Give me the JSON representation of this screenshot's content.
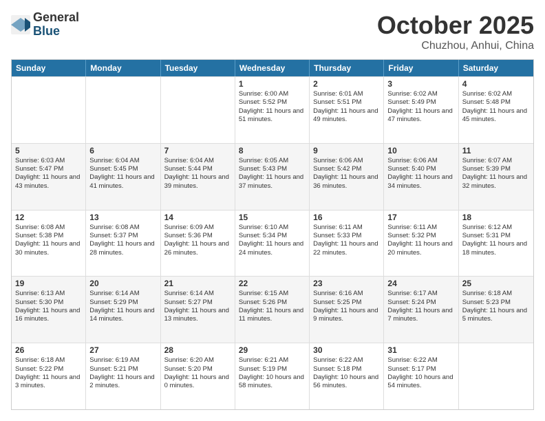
{
  "logo": {
    "general": "General",
    "blue": "Blue"
  },
  "title": "October 2025",
  "subtitle": "Chuzhou, Anhui, China",
  "headers": [
    "Sunday",
    "Monday",
    "Tuesday",
    "Wednesday",
    "Thursday",
    "Friday",
    "Saturday"
  ],
  "rows": [
    [
      {
        "day": "",
        "text": ""
      },
      {
        "day": "",
        "text": ""
      },
      {
        "day": "",
        "text": ""
      },
      {
        "day": "1",
        "text": "Sunrise: 6:00 AM\nSunset: 5:52 PM\nDaylight: 11 hours and 51 minutes."
      },
      {
        "day": "2",
        "text": "Sunrise: 6:01 AM\nSunset: 5:51 PM\nDaylight: 11 hours and 49 minutes."
      },
      {
        "day": "3",
        "text": "Sunrise: 6:02 AM\nSunset: 5:49 PM\nDaylight: 11 hours and 47 minutes."
      },
      {
        "day": "4",
        "text": "Sunrise: 6:02 AM\nSunset: 5:48 PM\nDaylight: 11 hours and 45 minutes."
      }
    ],
    [
      {
        "day": "5",
        "text": "Sunrise: 6:03 AM\nSunset: 5:47 PM\nDaylight: 11 hours and 43 minutes."
      },
      {
        "day": "6",
        "text": "Sunrise: 6:04 AM\nSunset: 5:45 PM\nDaylight: 11 hours and 41 minutes."
      },
      {
        "day": "7",
        "text": "Sunrise: 6:04 AM\nSunset: 5:44 PM\nDaylight: 11 hours and 39 minutes."
      },
      {
        "day": "8",
        "text": "Sunrise: 6:05 AM\nSunset: 5:43 PM\nDaylight: 11 hours and 37 minutes."
      },
      {
        "day": "9",
        "text": "Sunrise: 6:06 AM\nSunset: 5:42 PM\nDaylight: 11 hours and 36 minutes."
      },
      {
        "day": "10",
        "text": "Sunrise: 6:06 AM\nSunset: 5:40 PM\nDaylight: 11 hours and 34 minutes."
      },
      {
        "day": "11",
        "text": "Sunrise: 6:07 AM\nSunset: 5:39 PM\nDaylight: 11 hours and 32 minutes."
      }
    ],
    [
      {
        "day": "12",
        "text": "Sunrise: 6:08 AM\nSunset: 5:38 PM\nDaylight: 11 hours and 30 minutes."
      },
      {
        "day": "13",
        "text": "Sunrise: 6:08 AM\nSunset: 5:37 PM\nDaylight: 11 hours and 28 minutes."
      },
      {
        "day": "14",
        "text": "Sunrise: 6:09 AM\nSunset: 5:36 PM\nDaylight: 11 hours and 26 minutes."
      },
      {
        "day": "15",
        "text": "Sunrise: 6:10 AM\nSunset: 5:34 PM\nDaylight: 11 hours and 24 minutes."
      },
      {
        "day": "16",
        "text": "Sunrise: 6:11 AM\nSunset: 5:33 PM\nDaylight: 11 hours and 22 minutes."
      },
      {
        "day": "17",
        "text": "Sunrise: 6:11 AM\nSunset: 5:32 PM\nDaylight: 11 hours and 20 minutes."
      },
      {
        "day": "18",
        "text": "Sunrise: 6:12 AM\nSunset: 5:31 PM\nDaylight: 11 hours and 18 minutes."
      }
    ],
    [
      {
        "day": "19",
        "text": "Sunrise: 6:13 AM\nSunset: 5:30 PM\nDaylight: 11 hours and 16 minutes."
      },
      {
        "day": "20",
        "text": "Sunrise: 6:14 AM\nSunset: 5:29 PM\nDaylight: 11 hours and 14 minutes."
      },
      {
        "day": "21",
        "text": "Sunrise: 6:14 AM\nSunset: 5:27 PM\nDaylight: 11 hours and 13 minutes."
      },
      {
        "day": "22",
        "text": "Sunrise: 6:15 AM\nSunset: 5:26 PM\nDaylight: 11 hours and 11 minutes."
      },
      {
        "day": "23",
        "text": "Sunrise: 6:16 AM\nSunset: 5:25 PM\nDaylight: 11 hours and 9 minutes."
      },
      {
        "day": "24",
        "text": "Sunrise: 6:17 AM\nSunset: 5:24 PM\nDaylight: 11 hours and 7 minutes."
      },
      {
        "day": "25",
        "text": "Sunrise: 6:18 AM\nSunset: 5:23 PM\nDaylight: 11 hours and 5 minutes."
      }
    ],
    [
      {
        "day": "26",
        "text": "Sunrise: 6:18 AM\nSunset: 5:22 PM\nDaylight: 11 hours and 3 minutes."
      },
      {
        "day": "27",
        "text": "Sunrise: 6:19 AM\nSunset: 5:21 PM\nDaylight: 11 hours and 2 minutes."
      },
      {
        "day": "28",
        "text": "Sunrise: 6:20 AM\nSunset: 5:20 PM\nDaylight: 11 hours and 0 minutes."
      },
      {
        "day": "29",
        "text": "Sunrise: 6:21 AM\nSunset: 5:19 PM\nDaylight: 10 hours and 58 minutes."
      },
      {
        "day": "30",
        "text": "Sunrise: 6:22 AM\nSunset: 5:18 PM\nDaylight: 10 hours and 56 minutes."
      },
      {
        "day": "31",
        "text": "Sunrise: 6:22 AM\nSunset: 5:17 PM\nDaylight: 10 hours and 54 minutes."
      },
      {
        "day": "",
        "text": ""
      }
    ]
  ]
}
